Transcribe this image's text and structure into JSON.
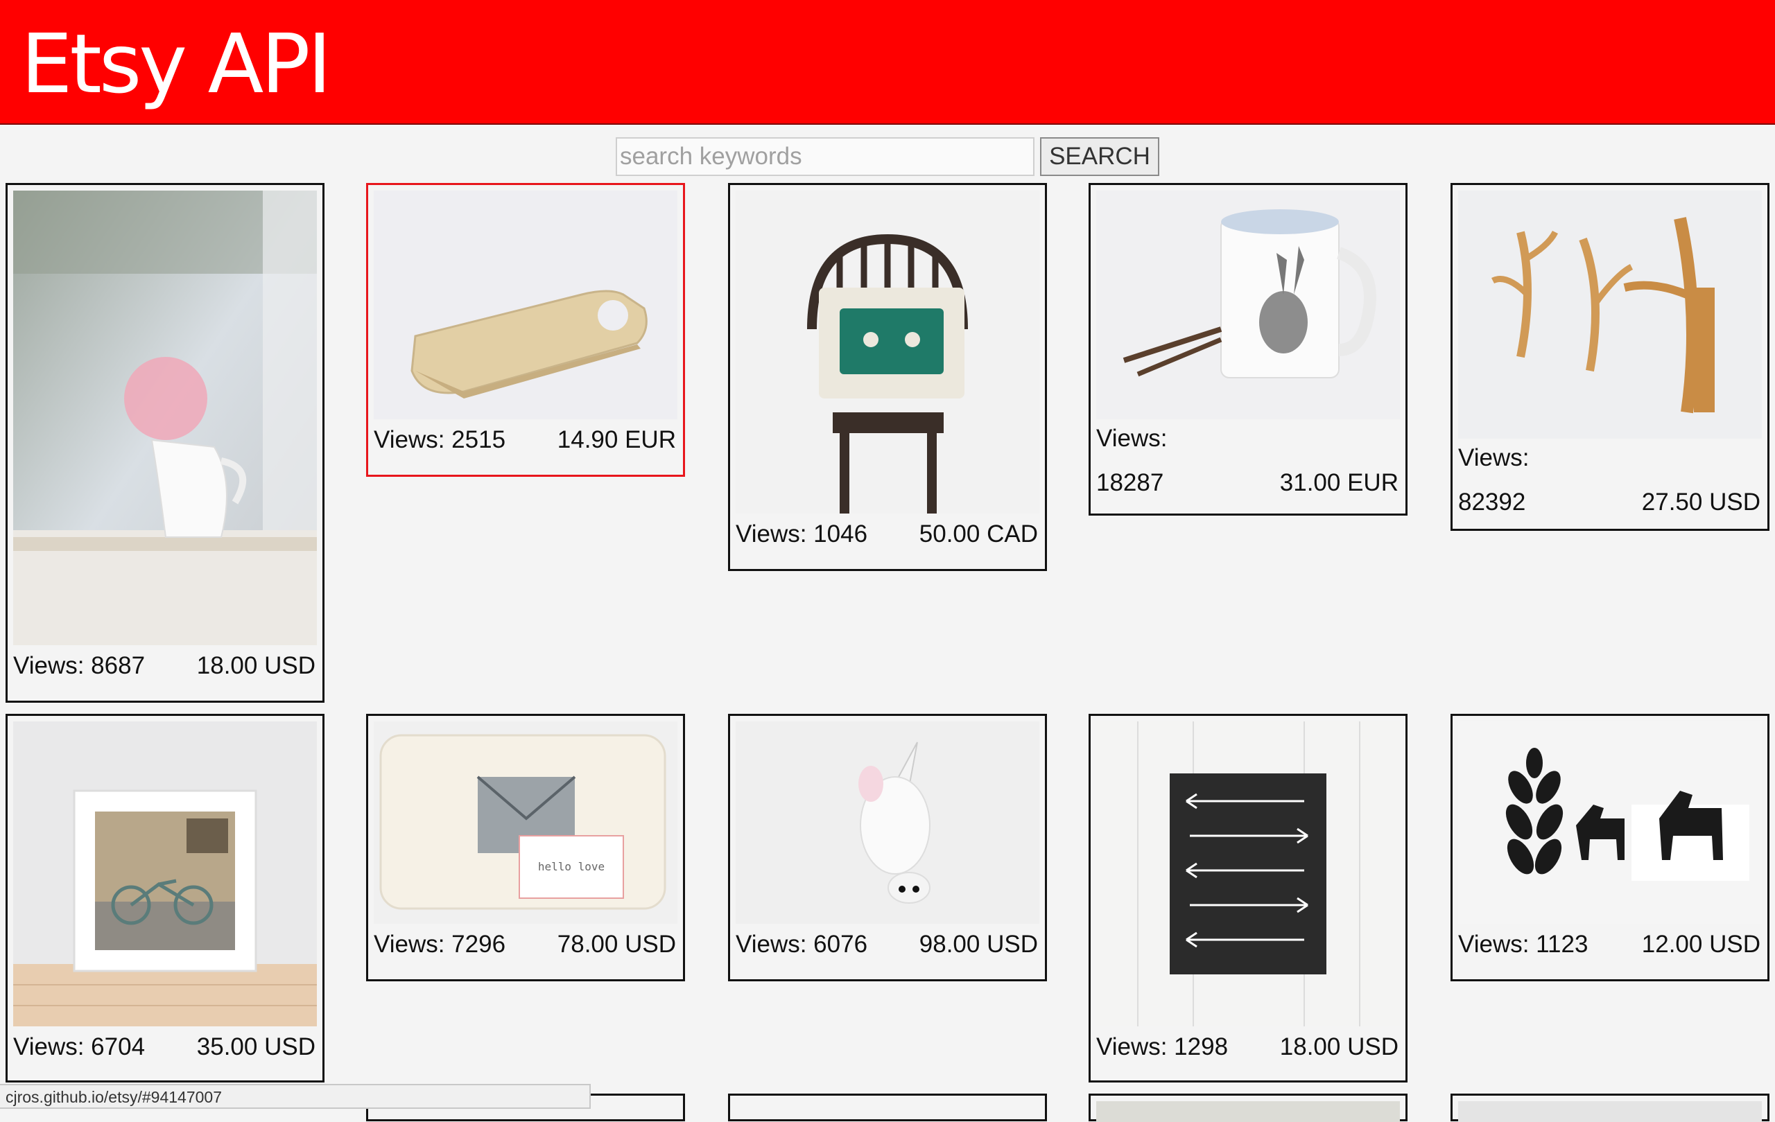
{
  "header": {
    "title": "Etsy API",
    "bg_color": "#ff0000"
  },
  "search": {
    "placeholder": "search keywords",
    "value": "",
    "button_label": "SEARCH"
  },
  "listings": [
    {
      "name": "vase-flowers-window",
      "views": "Views: 8687",
      "price": "18.00 USD"
    },
    {
      "name": "wooden-cutting-board",
      "views": "Views: 2515",
      "price": "14.90 EUR",
      "selected": true
    },
    {
      "name": "cassette-pillow-chair",
      "views": "Views: 1046",
      "price": "50.00 CAD"
    },
    {
      "name": "rabbit-mug",
      "views_label": "Views:",
      "views_value": "18287",
      "price": "31.00 EUR"
    },
    {
      "name": "antler-wall-hooks",
      "views_label": "Views:",
      "views_value": "82392",
      "price": "27.50 USD"
    },
    {
      "name": "bicycle-framed-print",
      "views": "Views: 6704",
      "price": "35.00 USD"
    },
    {
      "name": "hello-love-pillow",
      "views": "Views: 7296",
      "price": "78.00 USD"
    },
    {
      "name": "unicorn-head-wall",
      "views": "Views: 6076",
      "price": "98.00 USD"
    },
    {
      "name": "arrows-chalkboard-art",
      "views": "Views: 1298",
      "price": "18.00 USD"
    },
    {
      "name": "dala-horses-print",
      "views": "Views: 1123",
      "price": "12.00 USD"
    }
  ],
  "pillow_text": "hello love",
  "status_bar": {
    "url": "cjros.github.io/etsy/#94147007"
  },
  "colors": {
    "selected_border": "#e8161c",
    "card_border": "#111111",
    "page_bg": "#f4f4f4"
  }
}
